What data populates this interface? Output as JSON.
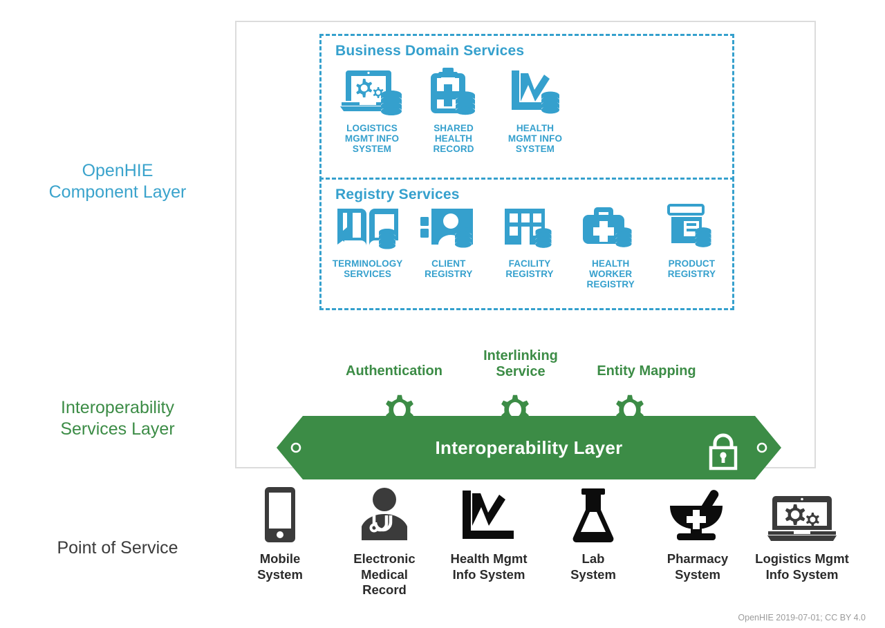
{
  "colors": {
    "blue": "#35a0cd",
    "green": "#3c8c46",
    "dark": "#2b2b2b",
    "border_gray": "#dcdcdc",
    "footer_gray": "#9b9b9b"
  },
  "rail_labels": {
    "component_layer": "OpenHIE\nComponent Layer",
    "interoperability_layer": "Interoperability\nServices Layer",
    "point_of_service": "Point of Service"
  },
  "business_domain_services": {
    "title": "Business Domain Services",
    "items": [
      {
        "icon": "laptop-gears-database-icon",
        "caption": "LOGISTICS\nMGMT INFO\nSYSTEM"
      },
      {
        "icon": "clipboard-cross-database-icon",
        "caption": "SHARED\nHEALTH\nRECORD"
      },
      {
        "icon": "line-chart-database-icon",
        "caption": "HEALTH\nMGMT INFO\nSYSTEM"
      }
    ]
  },
  "registry_services": {
    "title": "Registry Services",
    "items": [
      {
        "icon": "open-book-database-icon",
        "caption": "TERMINOLOGY\nSERVICES"
      },
      {
        "icon": "person-card-database-icon",
        "caption": "CLIENT\nREGISTRY"
      },
      {
        "icon": "building-database-icon",
        "caption": "FACILITY\nREGISTRY"
      },
      {
        "icon": "medical-bag-database-icon",
        "caption": "HEALTH\nWORKER\nREGISTRY"
      },
      {
        "icon": "pill-bottle-database-icon",
        "caption": "PRODUCT\nREGISTRY"
      }
    ]
  },
  "interoperability": {
    "band_label": "Interoperability Layer",
    "services": [
      {
        "icon": "gear-icon",
        "label": "Authentication"
      },
      {
        "icon": "gear-icon",
        "label": "Interlinking\nService"
      },
      {
        "icon": "gear-icon",
        "label": "Entity Mapping"
      }
    ],
    "lock_icon": "padlock-icon"
  },
  "point_of_service": {
    "items": [
      {
        "icon": "mobile-phone-icon",
        "caption": "Mobile\nSystem"
      },
      {
        "icon": "doctor-stethoscope-icon",
        "caption": "Electronic\nMedical\nRecord"
      },
      {
        "icon": "line-chart-icon",
        "caption": "Health Mgmt\nInfo System"
      },
      {
        "icon": "lab-flask-icon",
        "caption": "Lab\nSystem"
      },
      {
        "icon": "mortar-pestle-cross-icon",
        "caption": "Pharmacy\nSystem"
      },
      {
        "icon": "laptop-gears-icon",
        "caption": "Logistics Mgmt\nInfo System"
      }
    ]
  },
  "footer": {
    "credit": "OpenHIE 2019-07-01; CC BY 4.0"
  }
}
